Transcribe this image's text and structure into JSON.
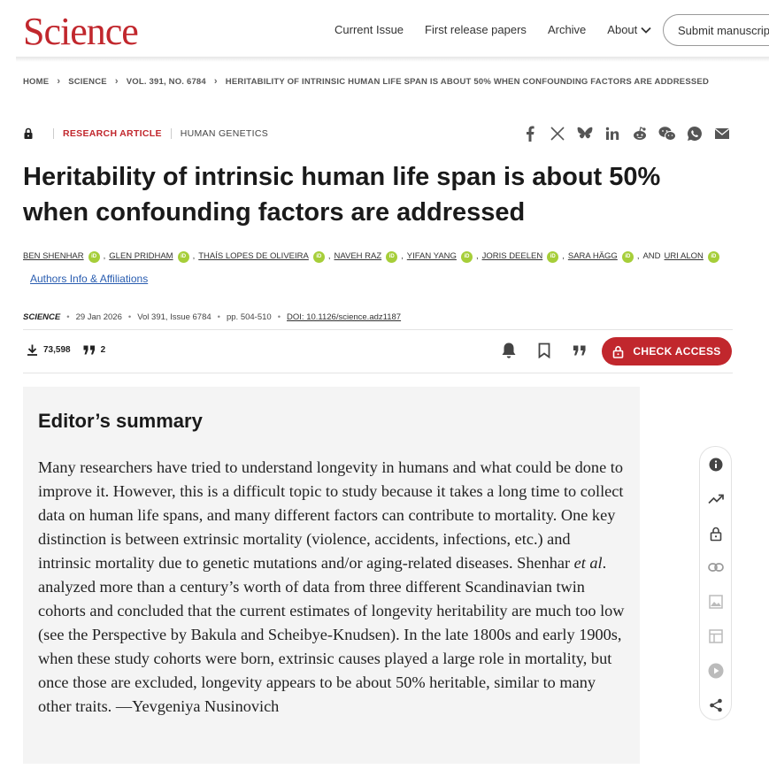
{
  "header": {
    "logo": "Science",
    "nav": [
      {
        "label": "Current Issue"
      },
      {
        "label": "First release papers"
      },
      {
        "label": "Archive"
      },
      {
        "label": "About"
      }
    ],
    "submit_label": "Submit manuscript"
  },
  "breadcrumb": [
    "HOME",
    "SCIENCE",
    "VOL. 391, NO. 6784",
    "HERITABILITY OF INTRINSIC HUMAN LIFE SPAN IS ABOUT 50% WHEN CONFOUNDING FACTORS ARE ADDRESSED"
  ],
  "article": {
    "type": "RESEARCH ARTICLE",
    "subject": "HUMAN GENETICS",
    "title": "Heritability of intrinsic human life span is about 50% when confounding factors are addressed",
    "authors": [
      "Ben Shenhar",
      "Glen Pridham",
      "Thaís Lopes De Oliveira",
      "Naveh Raz",
      "Yifan Yang",
      "Joris Deelen",
      "Sara Hägg",
      "Uri Alon"
    ],
    "and_text": "AND",
    "affiliations_link": "Authors Info & Affiliations",
    "orcid_label": "iD",
    "journal": "SCIENCE",
    "date": "29 Jan 2026",
    "volume": "Vol 391, Issue 6784",
    "pages": "pp. 504-510",
    "doi": "DOI: 10.1126/science.adz1187",
    "downloads": "73,598",
    "citations": "2",
    "check_access": "CHECK ACCESS"
  },
  "summary": {
    "heading": "Editor’s summary",
    "text_before_etal": "Many researchers have tried to understand longevity in humans and what could be done to improve it. However, this is a difficult topic to study because it takes a long time to collect data on human life spans, and many different factors can contribute to mortality. One key distinction is between extrinsic mortality (violence, accidents, infections, etc.) and intrinsic mortality due to genetic mutations and/or aging-related diseases. Shenhar ",
    "etal": "et al",
    "text_after_etal": ". analyzed more than a century’s worth of data from three different Scandinavian twin cohorts and concluded that the current estimates of longevity heritability are much too low (see the Perspective by Bakula and Scheibye-Knudsen). In the late 1800s and early 1900s, when these study cohorts were born, extrinsic causes played a large role in mortality, but once those are excluded, longevity appears to be about 50% heritable, similar to many other traits. —Yevgeniya Nusinovich"
  },
  "colors": {
    "brand": "#c1272d",
    "orcid": "#a6ce39",
    "link": "#2a5db0"
  }
}
